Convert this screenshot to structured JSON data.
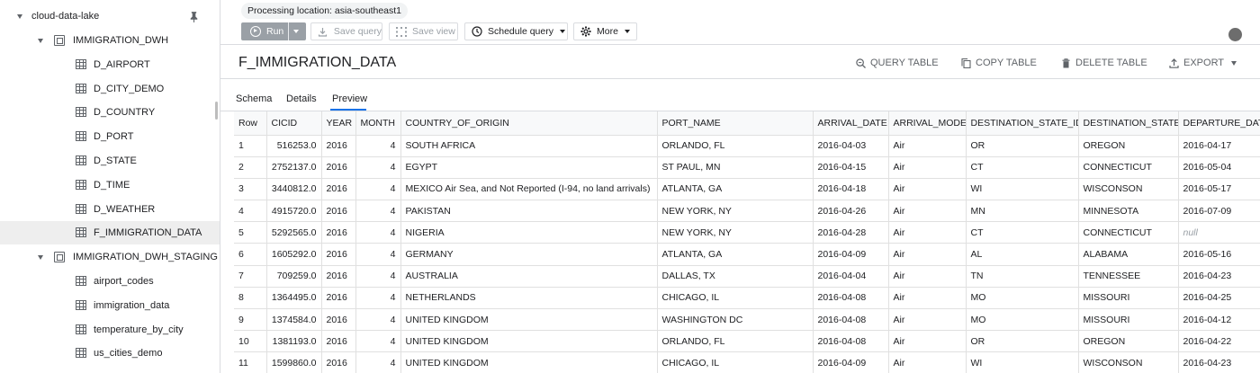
{
  "sidebar": {
    "project": "cloud-data-lake",
    "datasets": [
      {
        "name": "IMMIGRATION_DWH",
        "tables": [
          "D_AIRPORT",
          "D_CITY_DEMO",
          "D_COUNTRY",
          "D_PORT",
          "D_STATE",
          "D_TIME",
          "D_WEATHER",
          "F_IMMIGRATION_DATA"
        ]
      },
      {
        "name": "IMMIGRATION_DWH_STAGING",
        "tables": [
          "airport_codes",
          "immigration_data",
          "temperature_by_city",
          "us_cities_demo"
        ]
      }
    ],
    "selected_table": "F_IMMIGRATION_DATA"
  },
  "toolbar": {
    "processing_location": "Processing location: asia-southeast1",
    "run_label": "Run",
    "save_query_label": "Save query",
    "save_view_label": "Save view",
    "schedule_query_label": "Schedule query",
    "more_label": "More"
  },
  "header": {
    "title": "F_IMMIGRATION_DATA",
    "actions": {
      "query_table": "QUERY TABLE",
      "copy_table": "COPY TABLE",
      "delete_table": "DELETE TABLE",
      "export": "EXPORT"
    }
  },
  "tabs": [
    {
      "label": "Schema",
      "active": false
    },
    {
      "label": "Details",
      "active": false
    },
    {
      "label": "Preview",
      "active": true
    }
  ],
  "preview": {
    "columns": [
      "Row",
      "CICID",
      "YEAR",
      "MONTH",
      "COUNTRY_OF_ORIGIN",
      "PORT_NAME",
      "ARRIVAL_DATE",
      "ARRIVAL_MODE",
      "DESTINATION_STATE_ID",
      "DESTINATION_STATE",
      "DEPARTURE_DATE"
    ],
    "rows": [
      [
        "1",
        "516253.0",
        "2016",
        "4",
        "SOUTH AFRICA",
        "ORLANDO, FL",
        "2016-04-03",
        "Air",
        "OR",
        "OREGON",
        "2016-04-17"
      ],
      [
        "2",
        "2752137.0",
        "2016",
        "4",
        "EGYPT",
        "ST PAUL, MN",
        "2016-04-15",
        "Air",
        "CT",
        "CONNECTICUT",
        "2016-05-04"
      ],
      [
        "3",
        "3440812.0",
        "2016",
        "4",
        "MEXICO Air Sea, and Not Reported (I-94, no land arrivals)",
        "ATLANTA, GA",
        "2016-04-18",
        "Air",
        "WI",
        "WISCONSON",
        "2016-05-17"
      ],
      [
        "4",
        "4915720.0",
        "2016",
        "4",
        "PAKISTAN",
        "NEW YORK, NY",
        "2016-04-26",
        "Air",
        "MN",
        "MINNESOTA",
        "2016-07-09"
      ],
      [
        "5",
        "5292565.0",
        "2016",
        "4",
        "NIGERIA",
        "NEW YORK, NY",
        "2016-04-28",
        "Air",
        "CT",
        "CONNECTICUT",
        "null"
      ],
      [
        "6",
        "1605292.0",
        "2016",
        "4",
        "GERMANY",
        "ATLANTA, GA",
        "2016-04-09",
        "Air",
        "AL",
        "ALABAMA",
        "2016-05-16"
      ],
      [
        "7",
        "709259.0",
        "2016",
        "4",
        "AUSTRALIA",
        "DALLAS, TX",
        "2016-04-04",
        "Air",
        "TN",
        "TENNESSEE",
        "2016-04-23"
      ],
      [
        "8",
        "1364495.0",
        "2016",
        "4",
        "NETHERLANDS",
        "CHICAGO, IL",
        "2016-04-08",
        "Air",
        "MO",
        "MISSOURI",
        "2016-04-25"
      ],
      [
        "9",
        "1374584.0",
        "2016",
        "4",
        "UNITED KINGDOM",
        "WASHINGTON DC",
        "2016-04-08",
        "Air",
        "MO",
        "MISSOURI",
        "2016-04-12"
      ],
      [
        "10",
        "1381193.0",
        "2016",
        "4",
        "UNITED KINGDOM",
        "ORLANDO, FL",
        "2016-04-08",
        "Air",
        "OR",
        "OREGON",
        "2016-04-22"
      ],
      [
        "11",
        "1599860.0",
        "2016",
        "4",
        "UNITED KINGDOM",
        "CHICAGO, IL",
        "2016-04-09",
        "Air",
        "WI",
        "WISCONSON",
        "2016-04-23"
      ]
    ]
  },
  "colors": {
    "accent": "#1a73e8",
    "run_button": "#9aa0a6",
    "selected_row": "#eeeeee"
  }
}
